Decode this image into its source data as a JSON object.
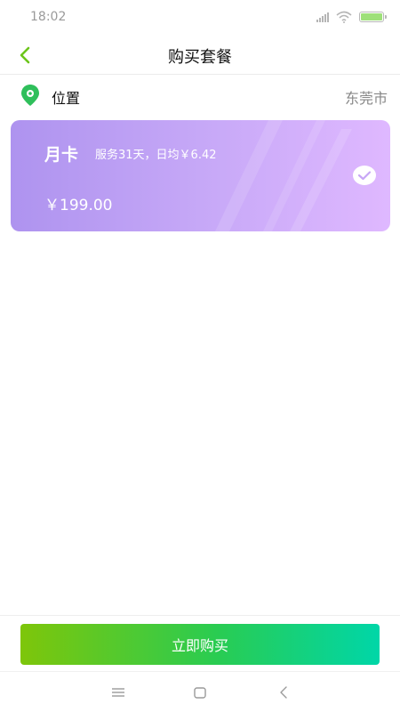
{
  "status_bar": {
    "time": "18:02",
    "icons": [
      "signal-icon",
      "wifi-icon",
      "battery-charging-icon"
    ]
  },
  "header": {
    "title": "购买套餐",
    "back_icon": "chevron-left-icon"
  },
  "location": {
    "label": "位置",
    "city": "东莞市",
    "icon": "map-pin-icon"
  },
  "plan": {
    "name": "月卡",
    "description": "服务31天，日均￥6.42",
    "price": "￥199.00",
    "selected": true,
    "icon": "check-circle-icon"
  },
  "actions": {
    "buy_label": "立即购买"
  },
  "system_nav": {
    "icons": [
      "menu-icon",
      "home-icon",
      "back-icon"
    ]
  },
  "colors": {
    "accent_green": "#6cc51b",
    "card_gradient_start": "#ae93ef",
    "card_gradient_end": "#dfb8ff",
    "button_gradient_start": "#7ec60a",
    "button_gradient_end": "#00d6a8"
  }
}
